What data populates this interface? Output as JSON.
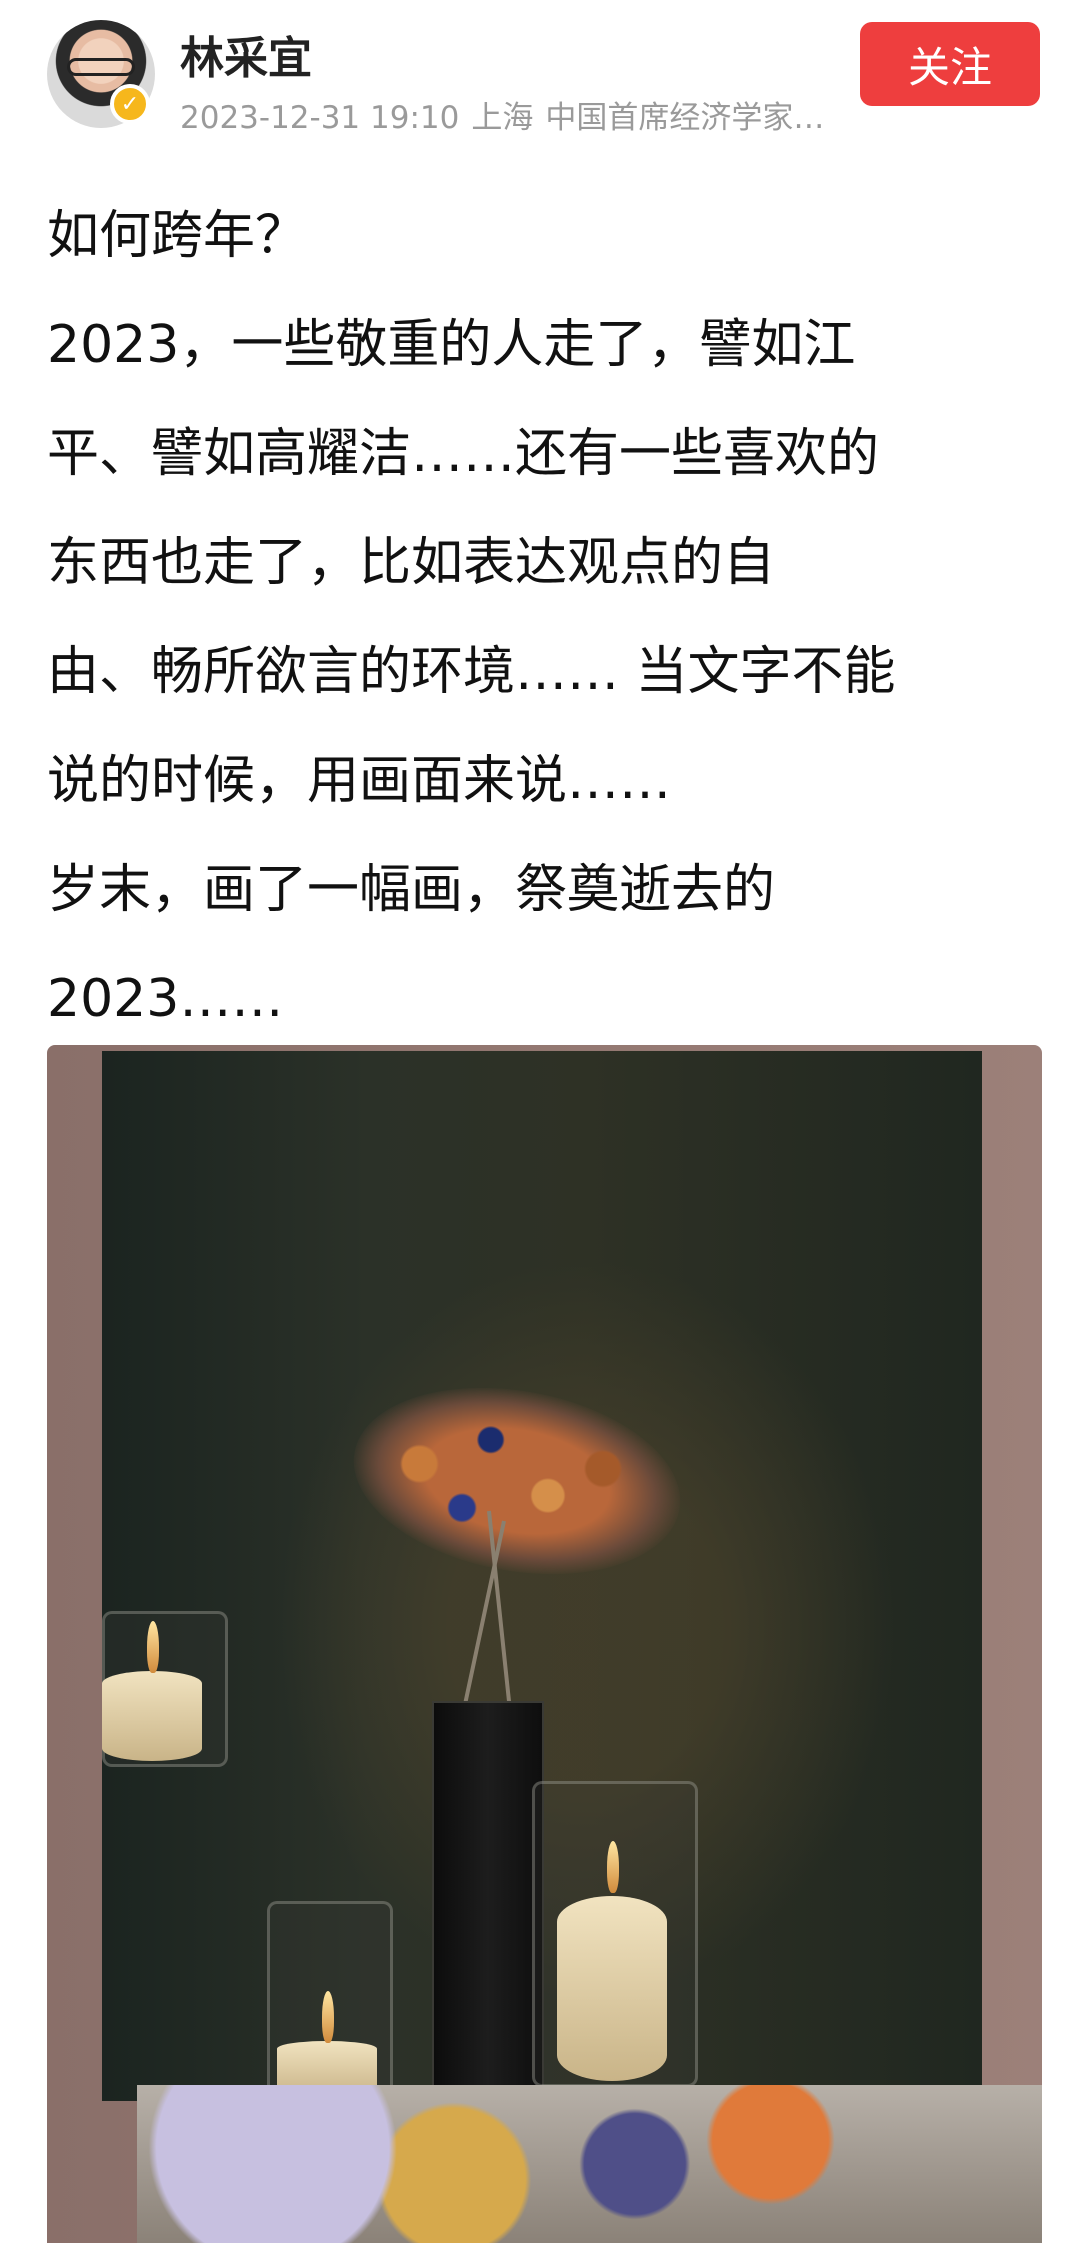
{
  "post": {
    "author": "林采宜",
    "timestamp": "2023-12-31 19:10",
    "location": "上海",
    "bio": "中国首席经济学家...",
    "follow_label": "关注",
    "lines": [
      "如何跨年？",
      "2023，一些敬重的人走了，譬如江",
      "平、譬如高耀洁……还有一些喜欢的",
      "东西也走了，比如表达观点的自",
      "由、畅所欲言的环境…… 当文字不能",
      "说的时候，用画面来说……",
      "岁末，画了一幅画，祭奠逝去的",
      "2023……"
    ]
  },
  "icons": {
    "verify_badge": "verified-badge-icon",
    "verify_symbol": "✓"
  },
  "colors": {
    "follow_button": "#ee3e3e",
    "meta_text": "#9a9a9a",
    "verify_badge": "#f6b71c"
  }
}
